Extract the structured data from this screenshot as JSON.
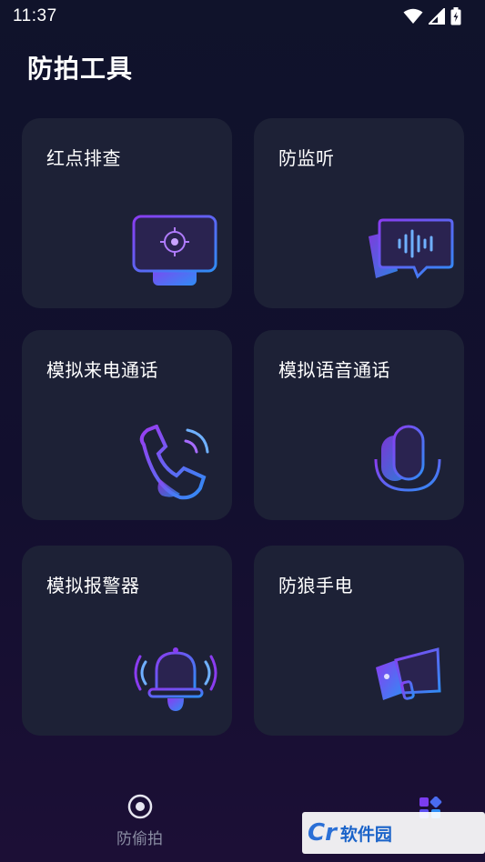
{
  "status_bar": {
    "time": "11:37"
  },
  "header": {
    "title": "防拍工具"
  },
  "cards": [
    {
      "label": "红点排查",
      "icon": "monitor-target-icon"
    },
    {
      "label": "防监听",
      "icon": "voice-chat-icon"
    },
    {
      "label": "模拟来电通话",
      "icon": "phone-call-icon"
    },
    {
      "label": "模拟语音通话",
      "icon": "microphone-icon"
    },
    {
      "label": "模拟报警器",
      "icon": "alarm-bell-icon"
    },
    {
      "label": "防狼手电",
      "icon": "megaphone-icon"
    }
  ],
  "bottom_nav": {
    "items": [
      {
        "label": "防偷拍",
        "icon": "camera-lens-icon"
      },
      {
        "label": "",
        "icon": "apps-grid-icon"
      }
    ]
  },
  "watermark": {
    "logo": "Cr",
    "text": "软件园"
  },
  "colors": {
    "background": "#10132b",
    "card": "#1d2136",
    "accent_start": "#7b3cf0",
    "accent_end": "#2f8df5",
    "nav_inactive": "#8a8da3"
  }
}
